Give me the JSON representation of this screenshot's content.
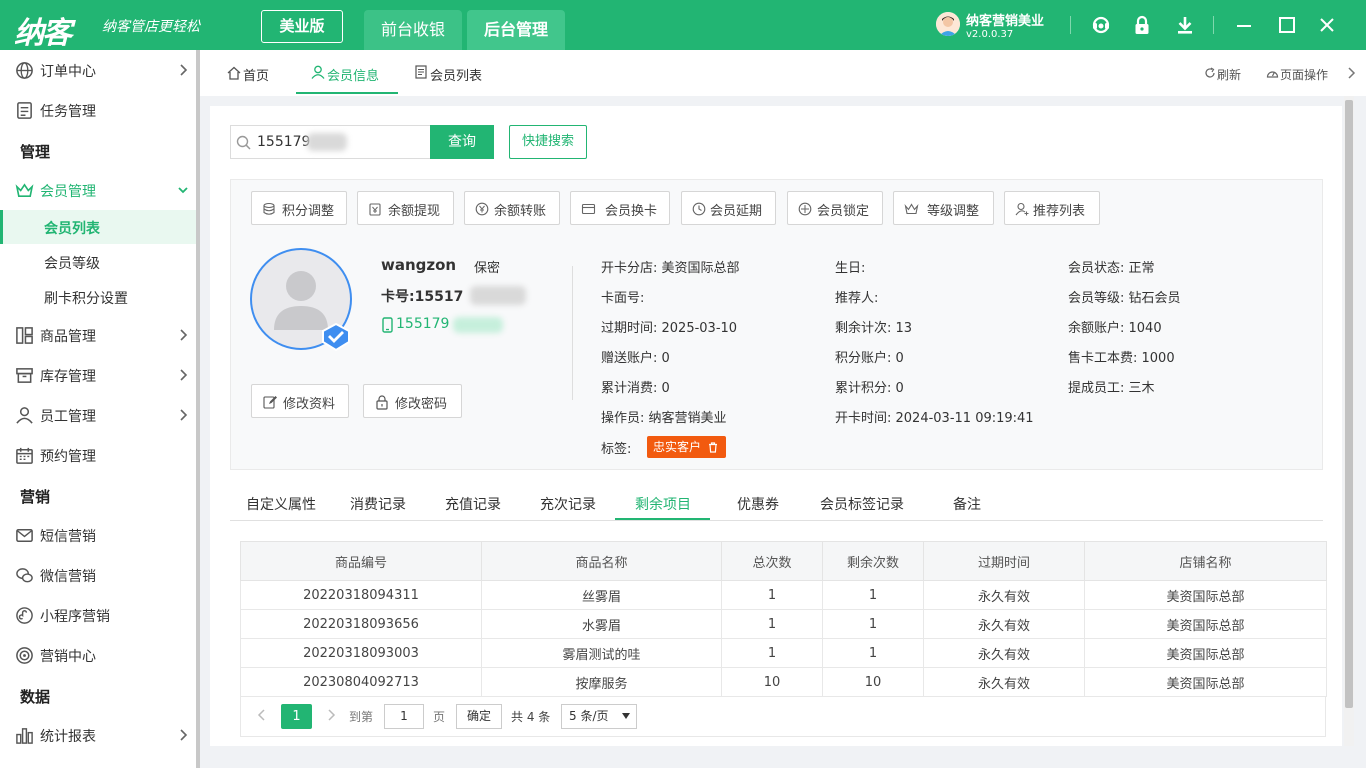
{
  "header": {
    "logo": "纳客",
    "slogan": "纳客管店更轻松",
    "edition": "美业版",
    "tabs": [
      "前台收银",
      "后台管理"
    ],
    "user_name": "纳客营销美业",
    "version": "v2.0.0.37",
    "accent": "#22b573"
  },
  "sidebar": {
    "items": [
      {
        "label": "订单中心",
        "icon": "globe-icon"
      },
      {
        "label": "任务管理",
        "icon": "task-icon"
      },
      {
        "group": "管理"
      },
      {
        "label": "会员管理",
        "icon": "crown-icon"
      },
      {
        "sub": "会员列表"
      },
      {
        "sub": "会员等级"
      },
      {
        "sub": "刷卡积分设置"
      },
      {
        "label": "商品管理",
        "icon": "goods-icon"
      },
      {
        "label": "库存管理",
        "icon": "stock-icon"
      },
      {
        "label": "员工管理",
        "icon": "staff-icon"
      },
      {
        "label": "预约管理",
        "icon": "calendar-icon"
      },
      {
        "group": "营销"
      },
      {
        "label": "短信营销",
        "icon": "mail-icon"
      },
      {
        "label": "微信营销",
        "icon": "wechat-icon"
      },
      {
        "label": "小程序营销",
        "icon": "miniapp-icon"
      },
      {
        "label": "营销中心",
        "icon": "target-icon"
      },
      {
        "group": "数据"
      },
      {
        "label": "统计报表",
        "icon": "chart-icon"
      }
    ]
  },
  "pagetabs": {
    "home": "首页",
    "member_info": "会员信息",
    "member_list": "会员列表",
    "refresh": "刷新",
    "page_ops": "页面操作"
  },
  "search": {
    "value": "155179",
    "query_btn": "查询",
    "quick_btn": "快捷搜索"
  },
  "actions": [
    "积分调整",
    "余额提现",
    "余额转账",
    "会员换卡",
    "会员延期",
    "会员锁定",
    "等级调整",
    "推荐列表"
  ],
  "member": {
    "name": "wangzon",
    "gender": "保密",
    "card_label": "卡号:",
    "card_no": "15517",
    "phone": "155179",
    "edit_btn": "修改资料",
    "pwd_btn": "修改密码",
    "fields": {
      "branch": "开卡分店:  美资国际总部",
      "birthday": "生日:",
      "status": "会员状态:  正常",
      "card_face": "卡面号:",
      "referrer": "推荐人:",
      "level": "会员等级:  钻石会员",
      "expire": "过期时间:  2025-03-10",
      "remain_times": "剩余计次:  13",
      "balance": "余额账户:  1040",
      "gift": "赠送账户:  0",
      "points": "积分账户:  0",
      "card_fee": "售卡工本费:  1000",
      "total_spend": "累计消费:  0",
      "total_points": "累计积分:  0",
      "commission_staff": "提成员工:  三木",
      "operator": "操作员:  纳客营销美业",
      "open_time": "开卡时间:  2024-03-11 09:19:41",
      "tags_label": "标签:"
    },
    "tag": "忠实客户"
  },
  "detail_tabs": [
    "自定义属性",
    "消费记录",
    "充值记录",
    "充次记录",
    "剩余项目",
    "优惠券",
    "会员标签记录",
    "备注"
  ],
  "table": {
    "headers": [
      "商品编号",
      "商品名称",
      "总次数",
      "剩余次数",
      "过期时间",
      "店铺名称"
    ],
    "rows": [
      [
        "20220318094311",
        "丝雾眉",
        "1",
        "1",
        "永久有效",
        "美资国际总部"
      ],
      [
        "20220318093656",
        "水雾眉",
        "1",
        "1",
        "永久有效",
        "美资国际总部"
      ],
      [
        "20220318093003",
        "雾眉测试的哇",
        "1",
        "1",
        "永久有效",
        "美资国际总部"
      ],
      [
        "20230804092713",
        "按摩服务",
        "10",
        "10",
        "永久有效",
        "美资国际总部"
      ]
    ]
  },
  "pager": {
    "current": "1",
    "goto": "到第",
    "page_input": "1",
    "page_unit": "页",
    "confirm": "确定",
    "total": "共 4 条",
    "size": "5 条/页"
  }
}
